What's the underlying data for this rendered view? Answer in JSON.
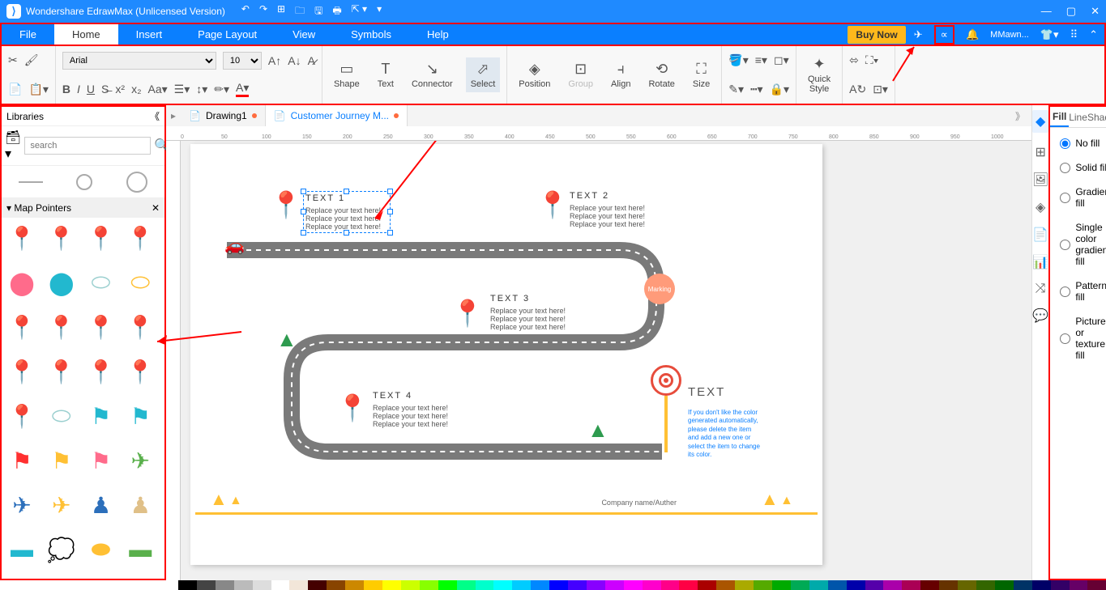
{
  "titlebar": {
    "app": "Wondershare EdrawMax (Unlicensed Version)"
  },
  "menubar": {
    "tabs": [
      "File",
      "Home",
      "Insert",
      "Page Layout",
      "View",
      "Symbols",
      "Help"
    ],
    "buy": "Buy Now",
    "user": "MMawn..."
  },
  "ribbon": {
    "font": "Arial",
    "size": "10",
    "shape": "Shape",
    "text": "Text",
    "connector": "Connector",
    "select": "Select",
    "position": "Position",
    "group": "Group",
    "align": "Align",
    "rotate": "Rotate",
    "size_btn": "Size",
    "quick_style": "Quick\nStyle"
  },
  "library": {
    "title": "Libraries",
    "search_placeholder": "search",
    "section": "Map Pointers",
    "pin_colors": [
      "#ff6b3d",
      "#22b8cf",
      "#ffc034",
      "#2c6fbb",
      "#ff6b8b",
      "#22b8cf",
      "#9acfcf",
      "#ffc034",
      "#ffc034",
      "#22b8cf",
      "#ff6b8b",
      "#2c6fbb",
      "#ffc034",
      "#22b8cf",
      "#ff6b8b",
      "#2c6fbb",
      "#22b8cf",
      "#9acfcf",
      "#22b8cf",
      "#22b8cf",
      "#ff3030",
      "#ffc034",
      "#ff6b8b",
      "#5ab04c",
      "#2c6fbb",
      "#ffc034",
      "#2c6fbb",
      "#e0c088",
      "#22b8cf",
      "#9acfcf",
      "#ffc034",
      "#5ab04c"
    ]
  },
  "doctabs": {
    "tab1": "Drawing1",
    "tab2": "Customer Journey M..."
  },
  "canvas": {
    "t1": {
      "hd": "TEXT 1",
      "l1": "Replace your text here!",
      "l2": "Replace your text here!",
      "l3": "Replace your text here!"
    },
    "t2": {
      "hd": "TEXT 2",
      "l1": "Replace your text here!",
      "l2": "Replace your text here!",
      "l3": "Replace your text here!"
    },
    "t3": {
      "hd": "TEXT 3",
      "l1": "Replace your text here!",
      "l2": "Replace your text here!",
      "l3": "Replace your text here!"
    },
    "t4": {
      "hd": "TEXT 4",
      "l1": "Replace your text here!",
      "l2": "Replace your text here!",
      "l3": "Replace your text here!"
    },
    "marking": "Marking",
    "t5_hd": "TEXT",
    "t5_body": "If you don't like the color generated automatically, please delete the item and add a new one or select the item to change its color.",
    "company": "Company name/Auther"
  },
  "rpanel": {
    "tabs": [
      "Fill",
      "Line",
      "Shadow"
    ],
    "options": [
      "No fill",
      "Solid fill",
      "Gradient fill",
      "Single color gradient fill",
      "Pattern fill",
      "Picture or texture fill"
    ]
  },
  "colorbar": [
    "#000",
    "#444",
    "#888",
    "#bbb",
    "#ddd",
    "#fff",
    "#f2e6d9",
    "#400",
    "#840",
    "#c80",
    "#fc0",
    "#ff0",
    "#cf0",
    "#8f0",
    "#0f0",
    "#0f8",
    "#0fc",
    "#0ff",
    "#0cf",
    "#08f",
    "#00f",
    "#40f",
    "#80f",
    "#c0f",
    "#f0f",
    "#f0c",
    "#f08",
    "#f04",
    "#a00",
    "#a50",
    "#aa0",
    "#5a0",
    "#0a0",
    "#0a5",
    "#0aa",
    "#05a",
    "#00a",
    "#50a",
    "#a0a",
    "#a05",
    "#600",
    "#630",
    "#660",
    "#360",
    "#060",
    "#036",
    "#006",
    "#306",
    "#606",
    "#603"
  ]
}
